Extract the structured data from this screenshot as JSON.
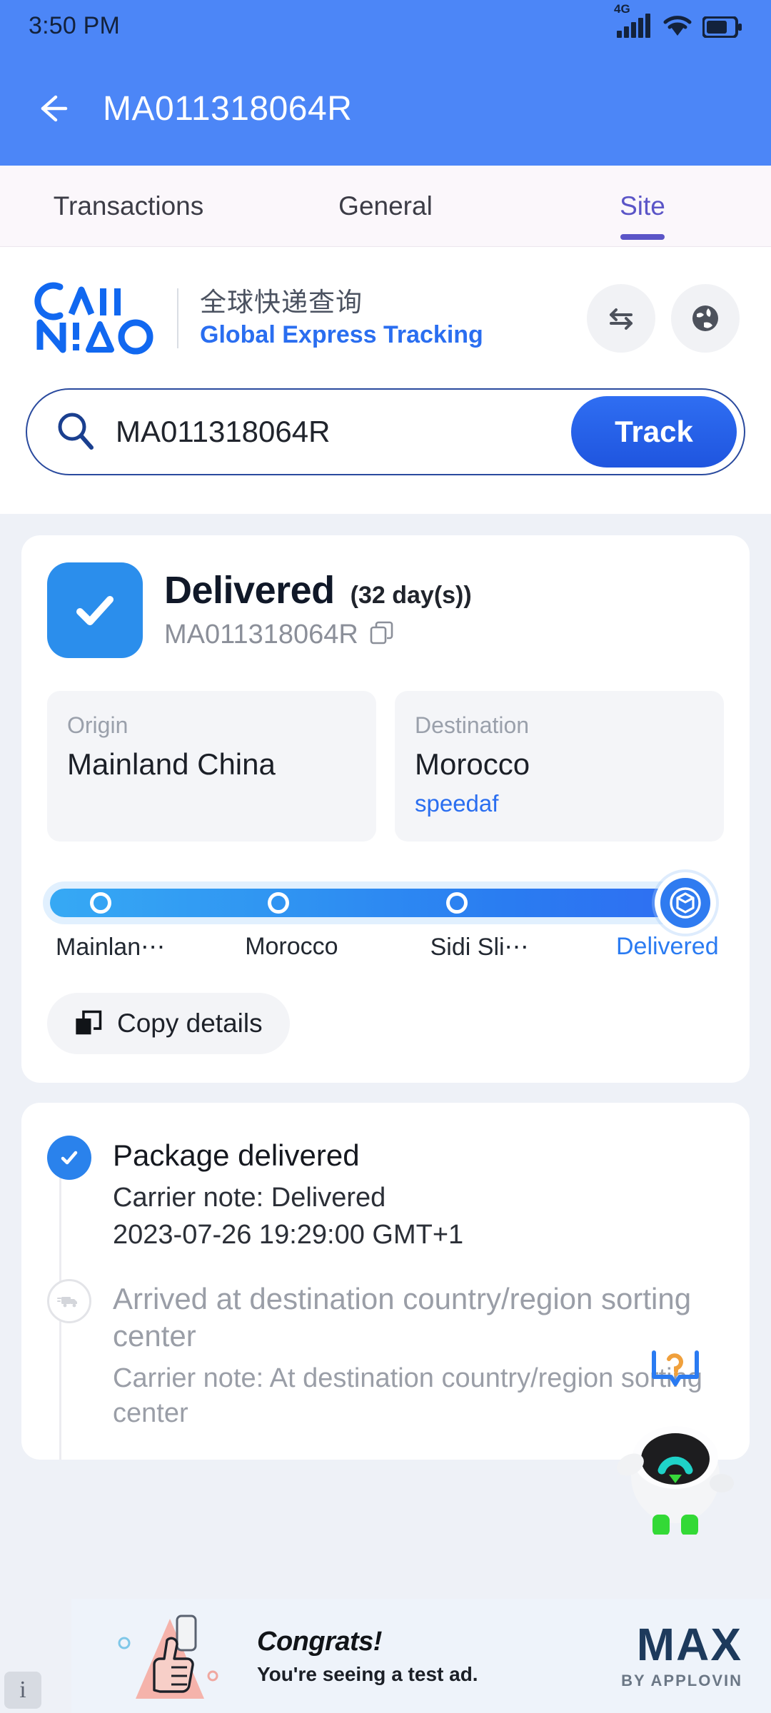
{
  "statusbar": {
    "time": "3:50 PM",
    "network": "4G",
    "icons": [
      "signal-icon",
      "wifi-icon",
      "battery-icon"
    ]
  },
  "appbar": {
    "back": "back-arrow-icon",
    "title": "MA011318064R"
  },
  "tabs": [
    {
      "label": "Transactions",
      "active": false
    },
    {
      "label": "General",
      "active": false
    },
    {
      "label": "Site",
      "active": true
    }
  ],
  "site_header": {
    "logo_text": "CAINIAO",
    "title_cn": "全球快递查询",
    "title_en": "Global Express Tracking",
    "buttons": [
      {
        "name": "swap-icon"
      },
      {
        "name": "globe-icon"
      }
    ]
  },
  "search": {
    "icon": "search-icon",
    "value": "MA011318064R",
    "placeholder": "MA011318064R",
    "button_label": "Track"
  },
  "summary": {
    "status": "Delivered",
    "days": "(32 day(s))",
    "tracking_number": "MA011318064R",
    "copy_icon": "copy-icon",
    "origin_label": "Origin",
    "origin_value": "Mainland China",
    "destination_label": "Destination",
    "destination_value": "Morocco",
    "carrier_link": "speedaf",
    "copy_details_label": "Copy details",
    "accent_color": "#2a7bf2"
  },
  "progress": {
    "steps": [
      {
        "label": "Mainlan⋯",
        "pos": 8,
        "state": "done"
      },
      {
        "label": "Morocco",
        "pos": 36,
        "state": "done"
      },
      {
        "label": "Sidi Sli⋯",
        "pos": 64,
        "state": "done"
      },
      {
        "label": "Delivered",
        "pos": 93,
        "state": "current"
      }
    ]
  },
  "timeline": [
    {
      "icon": "check-icon",
      "state": "done",
      "title": "Package delivered",
      "note": "Carrier note: Delivered",
      "time": "2023-07-26 19:29:00 GMT+1"
    },
    {
      "icon": "truck-icon",
      "state": "pending",
      "title": "Arrived at destination country/region sorting center",
      "note": "Carrier note: At destination country/region sorting center",
      "time": ""
    }
  ],
  "assistant": {
    "bubble_icon": "help-bubble-icon",
    "mascot": "robot-mascot-icon"
  },
  "ad": {
    "headline": "Congrats!",
    "subtext": "You're seeing a test ad.",
    "brand": "MAX",
    "brand_sub": "BY APPLOVIN",
    "info_badge": "i"
  }
}
